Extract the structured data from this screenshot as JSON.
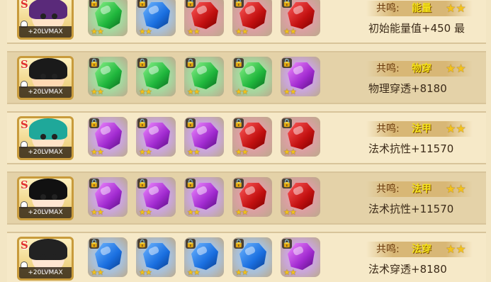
{
  "rows": [
    {
      "rank": "S",
      "level": "+20LVMAX",
      "portrait": "purple-haired-girl",
      "slots": [
        {
          "color": "green",
          "stars": "★★",
          "locked": true
        },
        {
          "color": "blue",
          "stars": "★★",
          "locked": true
        },
        {
          "color": "red",
          "stars": "★★",
          "locked": true
        },
        {
          "color": "red",
          "stars": "★★",
          "locked": true
        },
        {
          "color": "red",
          "stars": "★★",
          "locked": true
        }
      ],
      "resonance_label": "共鸣:",
      "resonance_type": "能量",
      "resonance_stars": "★★",
      "bonus": "初始能量值+450 最"
    },
    {
      "rank": "S",
      "level": "+20LVMAX",
      "portrait": "straw-hat-boy",
      "slots": [
        {
          "color": "green",
          "stars": "★★",
          "locked": true
        },
        {
          "color": "green",
          "stars": "★★",
          "locked": true
        },
        {
          "color": "green",
          "stars": "★★",
          "locked": true
        },
        {
          "color": "green",
          "stars": "★★",
          "locked": true
        },
        {
          "color": "purple",
          "stars": "★★",
          "locked": true
        }
      ],
      "resonance_label": "共鸣:",
      "resonance_type": "物穿",
      "resonance_stars": "★★",
      "bonus": "物理穿透+8180"
    },
    {
      "rank": "S",
      "level": "+20LVMAX",
      "portrait": "teal-haired-girl",
      "slots": [
        {
          "color": "purple",
          "stars": "★★",
          "locked": true
        },
        {
          "color": "purple",
          "stars": "★★",
          "locked": true
        },
        {
          "color": "purple",
          "stars": "★★",
          "locked": true
        },
        {
          "color": "red",
          "stars": "★★",
          "locked": true
        },
        {
          "color": "red",
          "stars": "★★",
          "locked": true
        }
      ],
      "resonance_label": "共鸣:",
      "resonance_type": "法甲",
      "resonance_stars": "★★",
      "bonus": "法术抗性+11570"
    },
    {
      "rank": "S",
      "level": "+20LVMAX",
      "portrait": "black-haired-woman",
      "slots": [
        {
          "color": "purple",
          "stars": "★★",
          "locked": true
        },
        {
          "color": "purple",
          "stars": "★★",
          "locked": true
        },
        {
          "color": "purple",
          "stars": "★★",
          "locked": true
        },
        {
          "color": "red",
          "stars": "★★",
          "locked": true
        },
        {
          "color": "red",
          "stars": "★★",
          "locked": true
        }
      ],
      "resonance_label": "共鸣:",
      "resonance_type": "法甲",
      "resonance_stars": "★★",
      "bonus": "法术抗性+11570"
    },
    {
      "rank": "S",
      "level": "+20LVMAX",
      "portrait": "dark-haired-girl",
      "slots": [
        {
          "color": "blue",
          "stars": "★★",
          "locked": true
        },
        {
          "color": "blue",
          "stars": "★★",
          "locked": true
        },
        {
          "color": "blue",
          "stars": "★★",
          "locked": true
        },
        {
          "color": "blue",
          "stars": "★★",
          "locked": true
        },
        {
          "color": "purple",
          "stars": "★★",
          "locked": true
        }
      ],
      "resonance_label": "共鸣:",
      "resonance_type": "法穿",
      "resonance_stars": "★★",
      "bonus": "法术穿透+8180"
    }
  ],
  "icons": {
    "lock": "lock-icon",
    "star": "star-icon",
    "chef": "chef-hat-icon"
  },
  "colors": {
    "gem_red": "#c21010",
    "gem_green": "#1fb63c",
    "gem_blue": "#1a6fe0",
    "gem_purple": "#a12ad0",
    "resonance_type": "#f6e41a"
  }
}
